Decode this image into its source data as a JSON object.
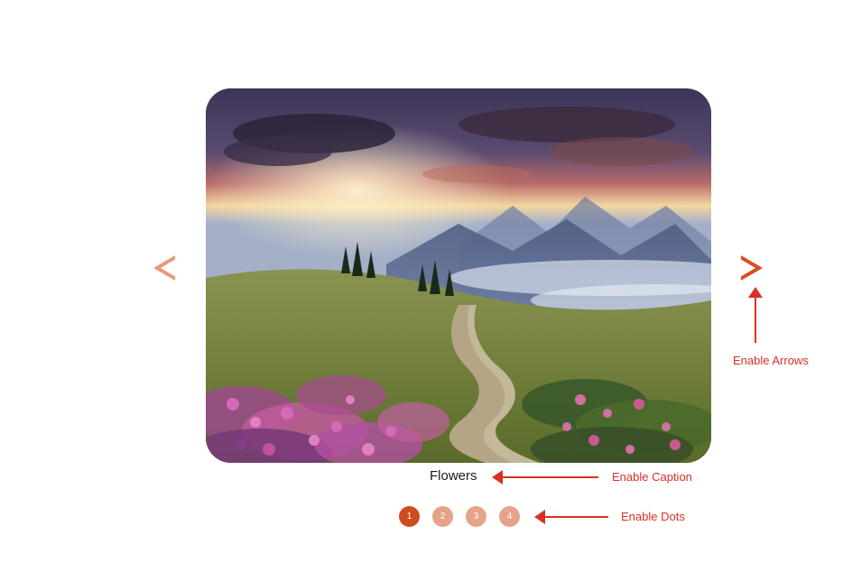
{
  "carousel": {
    "caption": "Flowers",
    "dots": [
      "1",
      "2",
      "3",
      "4"
    ],
    "active_dot": 0
  },
  "annotations": {
    "arrows_label": "Enable Arrows",
    "caption_label": "Enable Caption",
    "dots_label": "Enable Dots"
  }
}
